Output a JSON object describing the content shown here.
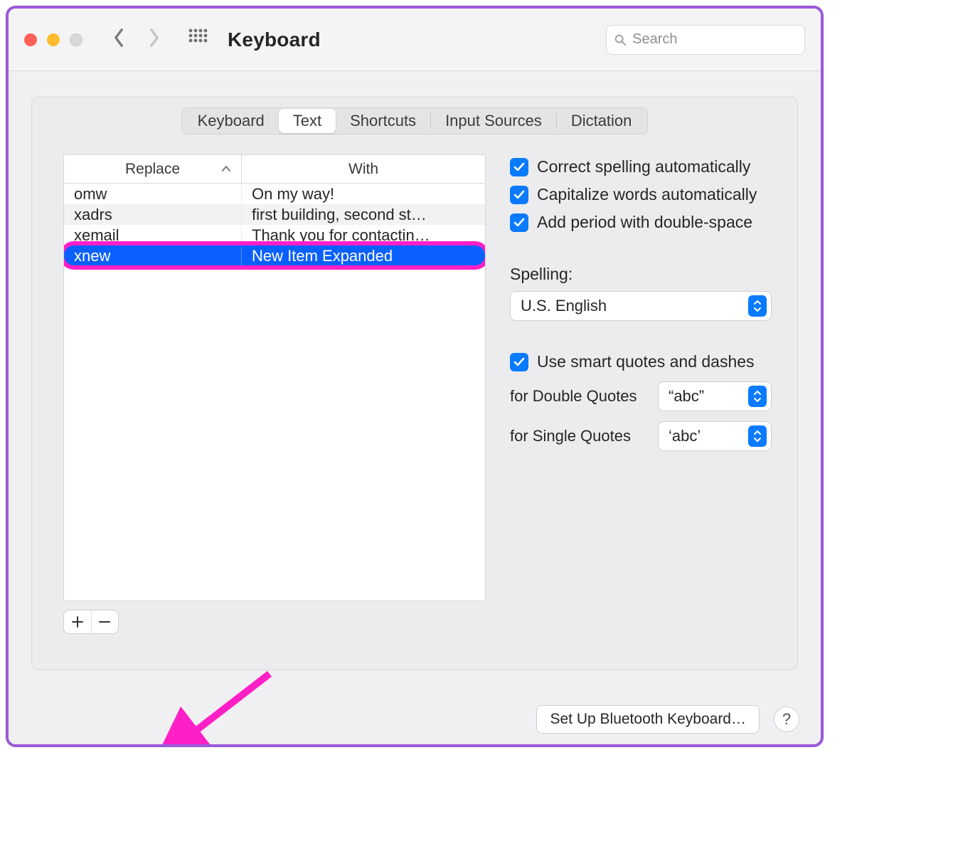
{
  "titlebar": {
    "title": "Keyboard",
    "search_placeholder": "Search"
  },
  "tabs": {
    "items": [
      "Keyboard",
      "Text",
      "Shortcuts",
      "Input Sources",
      "Dictation"
    ],
    "active_index": 1
  },
  "table": {
    "headers": {
      "replace": "Replace",
      "with": "With"
    },
    "rows": [
      {
        "replace": "omw",
        "with": "On my way!",
        "selected": false
      },
      {
        "replace": "xadrs",
        "with": "first building, second st…",
        "selected": false
      },
      {
        "replace": "xemail",
        "with": "Thank you for contactin…",
        "selected": false
      },
      {
        "replace": "xnew",
        "with": "New Item Expanded",
        "selected": true
      }
    ]
  },
  "options": {
    "correct_spelling": "Correct spelling automatically",
    "capitalize": "Capitalize words automatically",
    "add_period": "Add period with double-space",
    "smart_quotes": "Use smart quotes and dashes",
    "spelling_label": "Spelling:",
    "spelling_value": "U.S. English",
    "double_label": "for Double Quotes",
    "double_value": "“abc”",
    "single_label": "for Single Quotes",
    "single_value": "‘abc’"
  },
  "buttons": {
    "bluetooth": "Set Up Bluetooth Keyboard…"
  }
}
